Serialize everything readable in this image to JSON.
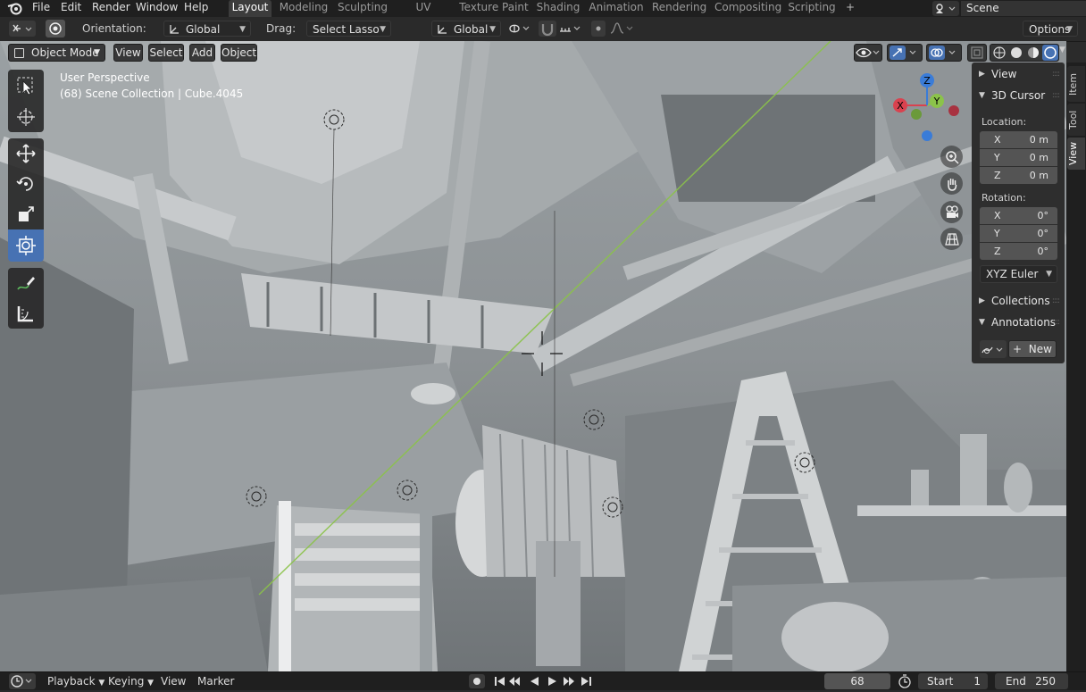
{
  "menu": [
    "File",
    "Edit",
    "Render",
    "Window",
    "Help"
  ],
  "workspaces": {
    "active": "Layout",
    "tabs": [
      "Layout",
      "Modeling",
      "Sculpting",
      "UV Editing",
      "Texture Paint",
      "Shading",
      "Animation",
      "Rendering",
      "Compositing",
      "Scripting"
    ]
  },
  "scene": {
    "name": "Scene"
  },
  "tool_header": {
    "orientation_label": "Orientation:",
    "orientation_value": "Global",
    "drag_label": "Drag:",
    "drag_value": "Select Lasso",
    "transform_orientation": "Global",
    "options_label": "Options"
  },
  "viewport_header": {
    "mode": "Object Mode",
    "menus": [
      "View",
      "Select",
      "Add",
      "Object"
    ]
  },
  "overlay": {
    "perspective": "User Perspective",
    "collection_info": "(68) Scene Collection | Cube.4045"
  },
  "gizmo": {
    "x": "X",
    "y": "Y",
    "z": "Z"
  },
  "sidebar": {
    "tabs": [
      "Item",
      "Tool",
      "View"
    ],
    "active_tab": "View",
    "view_panel": "View",
    "cursor_panel": "3D Cursor",
    "location_label": "Location:",
    "location": [
      {
        "axis": "X",
        "value": "0 m"
      },
      {
        "axis": "Y",
        "value": "0 m"
      },
      {
        "axis": "Z",
        "value": "0 m"
      }
    ],
    "rotation_label": "Rotation:",
    "rotation": [
      {
        "axis": "X",
        "value": "0°"
      },
      {
        "axis": "Y",
        "value": "0°"
      },
      {
        "axis": "Z",
        "value": "0°"
      }
    ],
    "rotation_mode": "XYZ Euler",
    "collections_panel": "Collections",
    "annotations_panel": "Annotations",
    "new_label": "New"
  },
  "timeline": {
    "playback": "Playback",
    "keying": "Keying",
    "view": "View",
    "marker": "Marker",
    "current_frame": "68",
    "start_label": "Start",
    "start": "1",
    "end_label": "End",
    "end": "250"
  },
  "colors": {
    "accent": "#4772b3",
    "axis_x": "#d9424f",
    "axis_y": "#8bc34a",
    "axis_z": "#3a7cd8"
  }
}
